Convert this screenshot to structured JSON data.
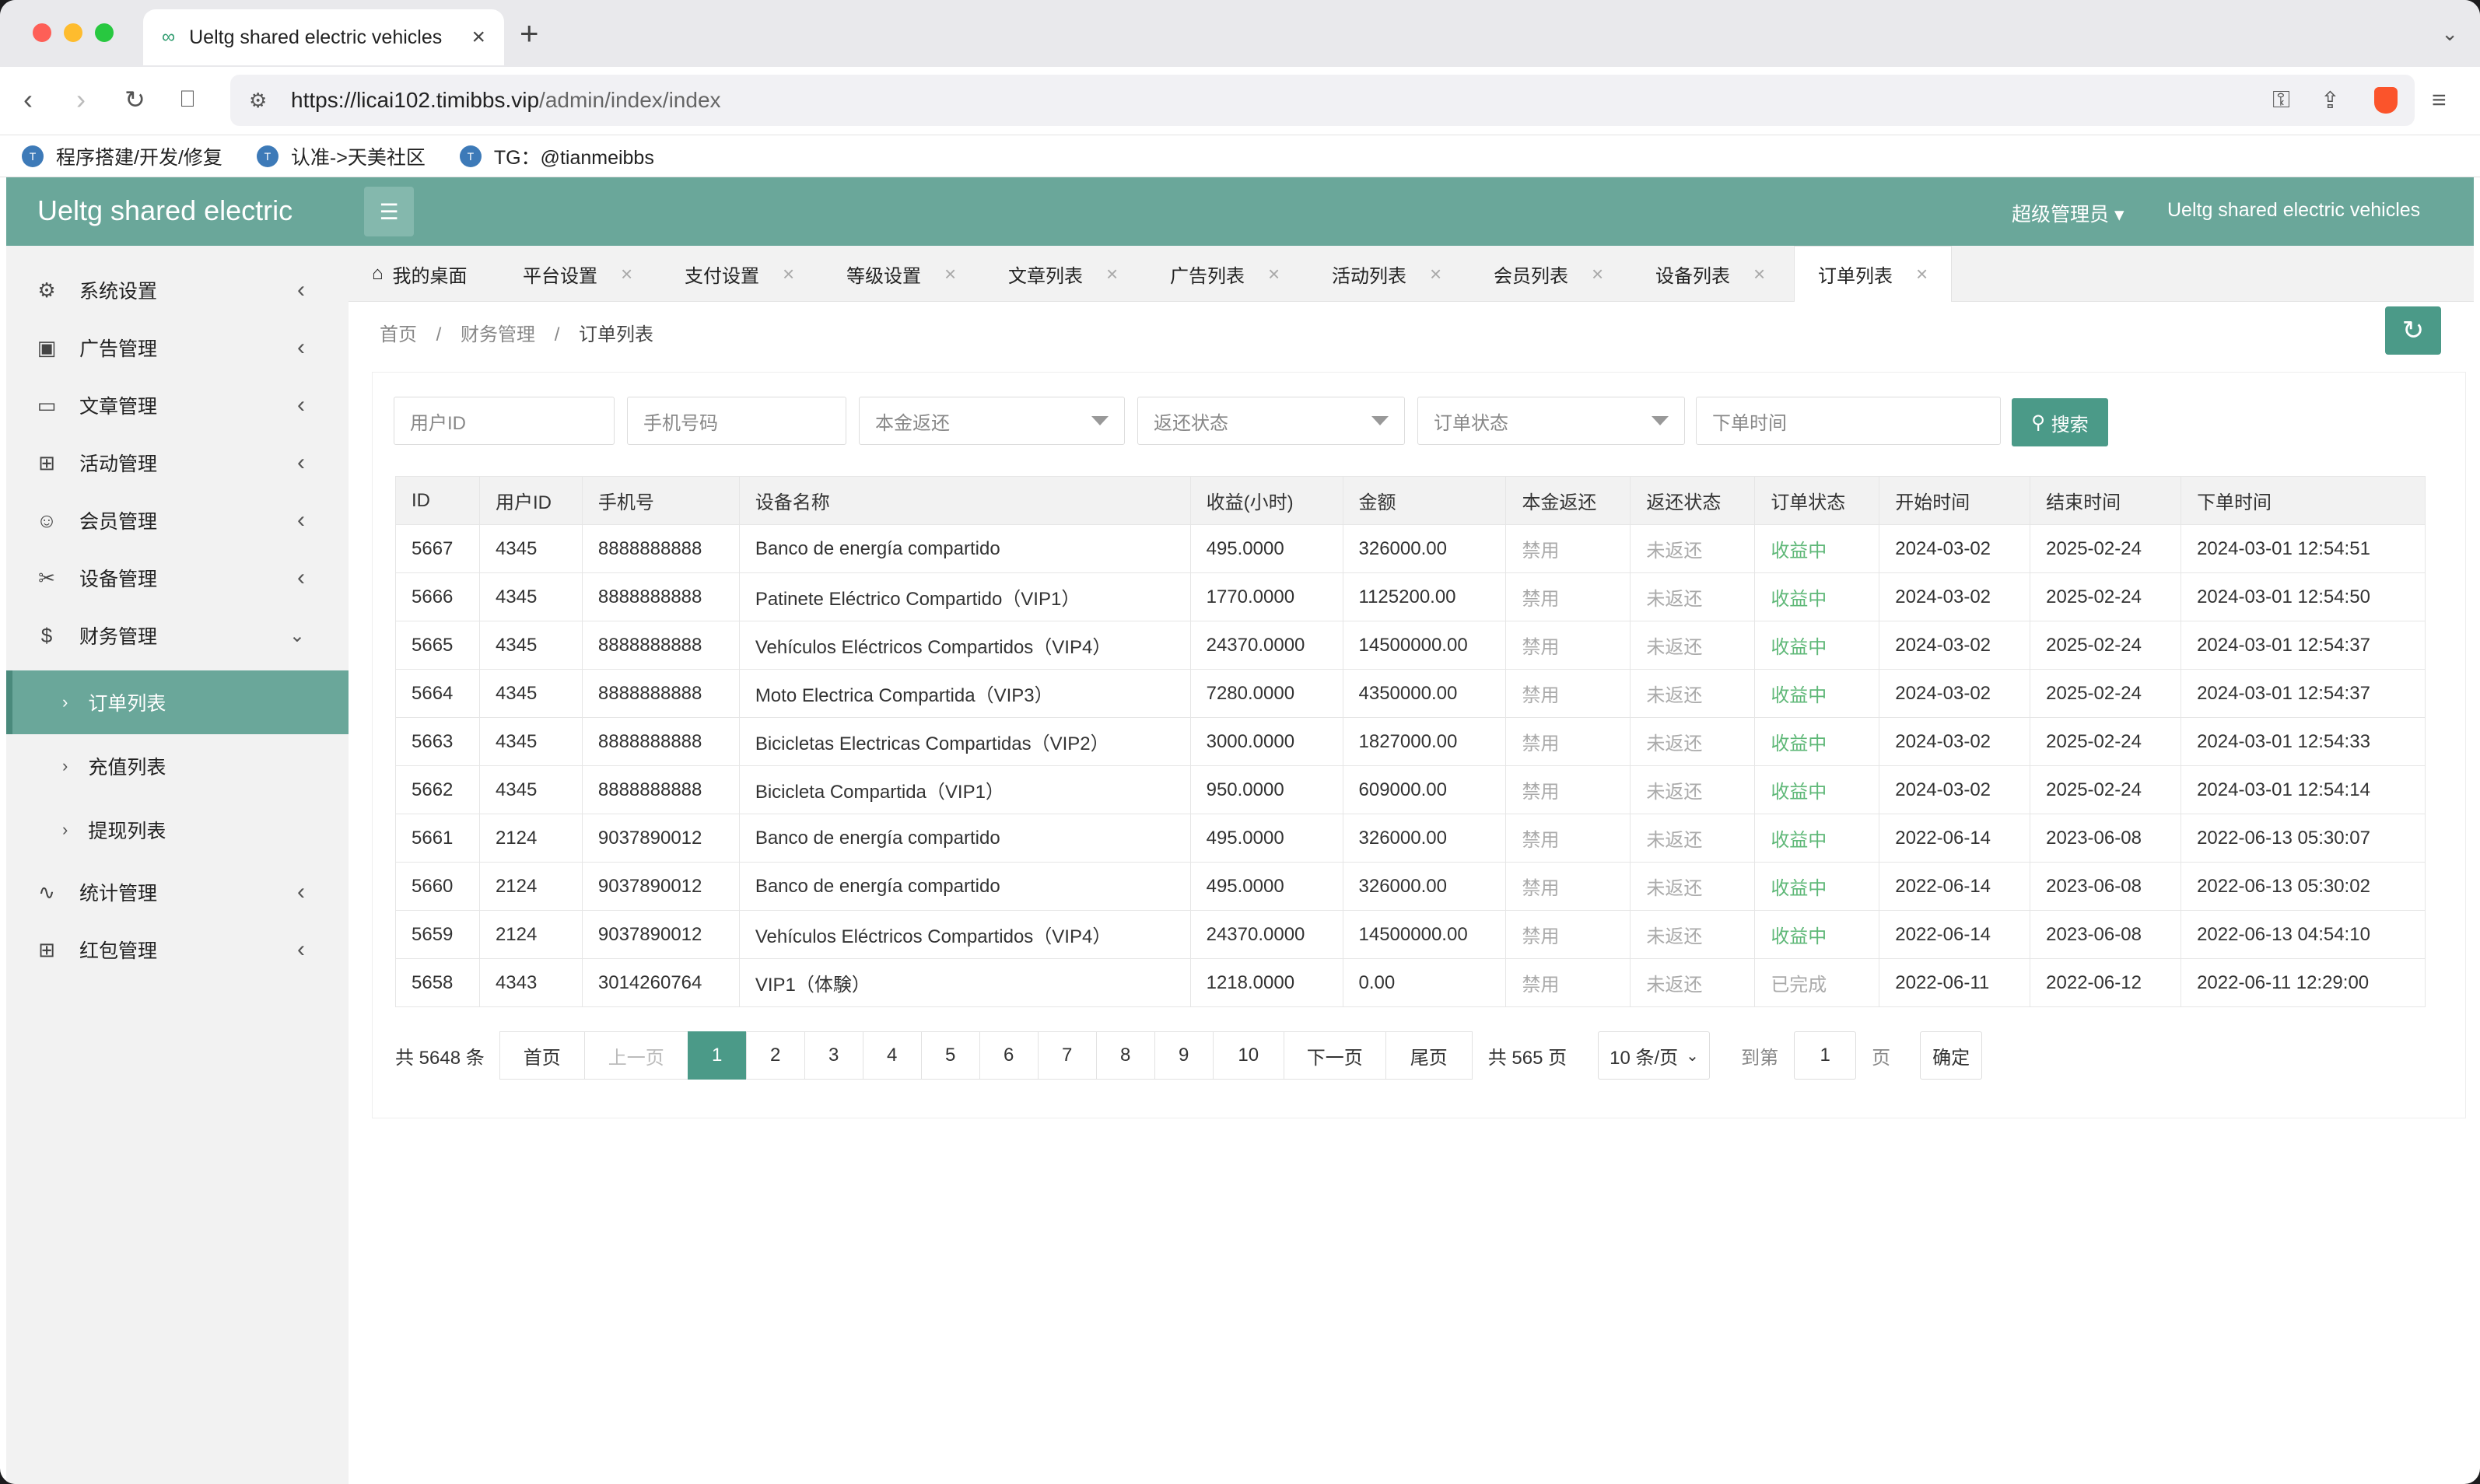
{
  "browser": {
    "tab_title": "Ueltg shared electric vehicles",
    "url_host": "https://licai102.timibbs.vip",
    "url_path": "/admin/index/index",
    "bookmarks": [
      "程序搭建/开发/修复",
      "认准->天美社区",
      "TG：@tianmeibbs"
    ]
  },
  "header": {
    "logo": "Ueltg shared electric",
    "user": "超级管理员",
    "site_name": "Ueltg shared electric vehicles"
  },
  "sidebar": {
    "items": [
      {
        "label": "系统设置",
        "icon": "gear-icon"
      },
      {
        "label": "广告管理",
        "icon": "image-icon"
      },
      {
        "label": "文章管理",
        "icon": "book-icon"
      },
      {
        "label": "活动管理",
        "icon": "gift-icon"
      },
      {
        "label": "会员管理",
        "icon": "user-icon"
      },
      {
        "label": "设备管理",
        "icon": "tools-icon"
      },
      {
        "label": "财务管理",
        "icon": "dollar-icon"
      },
      {
        "label": "统计管理",
        "icon": "pulse-icon"
      },
      {
        "label": "红包管理",
        "icon": "gift-icon"
      }
    ],
    "finance_sub": [
      "订单列表",
      "充值列表",
      "提现列表"
    ]
  },
  "tabs": [
    "我的桌面",
    "平台设置",
    "支付设置",
    "等级设置",
    "文章列表",
    "广告列表",
    "活动列表",
    "会员列表",
    "设备列表",
    "订单列表"
  ],
  "breadcrumb": [
    "首页",
    "财务管理",
    "订单列表"
  ],
  "filters": {
    "user_id": "用户ID",
    "phone": "手机号码",
    "principal_return": "本金返还",
    "return_status": "返还状态",
    "order_status": "订单状态",
    "order_time": "下单时间",
    "search": "搜索"
  },
  "table": {
    "headers": [
      "ID",
      "用户ID",
      "手机号",
      "设备名称",
      "收益(小时)",
      "金额",
      "本金返还",
      "返还状态",
      "订单状态",
      "开始时间",
      "结束时间",
      "下单时间"
    ],
    "rows": [
      [
        "5667",
        "4345",
        "8888888888",
        "Banco de energía compartido",
        "495.0000",
        "326000.00",
        "禁用",
        "未返还",
        "收益中",
        "2024-03-02",
        "2025-02-24",
        "2024-03-01 12:54:51"
      ],
      [
        "5666",
        "4345",
        "8888888888",
        "Patinete Eléctrico Compartido（VIP1）",
        "1770.0000",
        "1125200.00",
        "禁用",
        "未返还",
        "收益中",
        "2024-03-02",
        "2025-02-24",
        "2024-03-01 12:54:50"
      ],
      [
        "5665",
        "4345",
        "8888888888",
        "Vehículos Eléctricos Compartidos（VIP4）",
        "24370.0000",
        "14500000.00",
        "禁用",
        "未返还",
        "收益中",
        "2024-03-02",
        "2025-02-24",
        "2024-03-01 12:54:37"
      ],
      [
        "5664",
        "4345",
        "8888888888",
        "Moto Electrica Compartida（VIP3）",
        "7280.0000",
        "4350000.00",
        "禁用",
        "未返还",
        "收益中",
        "2024-03-02",
        "2025-02-24",
        "2024-03-01 12:54:37"
      ],
      [
        "5663",
        "4345",
        "8888888888",
        "Bicicletas Electricas Compartidas（VIP2）",
        "3000.0000",
        "1827000.00",
        "禁用",
        "未返还",
        "收益中",
        "2024-03-02",
        "2025-02-24",
        "2024-03-01 12:54:33"
      ],
      [
        "5662",
        "4345",
        "8888888888",
        "Bicicleta Compartida（VIP1）",
        "950.0000",
        "609000.00",
        "禁用",
        "未返还",
        "收益中",
        "2024-03-02",
        "2025-02-24",
        "2024-03-01 12:54:14"
      ],
      [
        "5661",
        "2124",
        "9037890012",
        "Banco de energía compartido",
        "495.0000",
        "326000.00",
        "禁用",
        "未返还",
        "收益中",
        "2022-06-14",
        "2023-06-08",
        "2022-06-13 05:30:07"
      ],
      [
        "5660",
        "2124",
        "9037890012",
        "Banco de energía compartido",
        "495.0000",
        "326000.00",
        "禁用",
        "未返还",
        "收益中",
        "2022-06-14",
        "2023-06-08",
        "2022-06-13 05:30:02"
      ],
      [
        "5659",
        "2124",
        "9037890012",
        "Vehículos Eléctricos Compartidos（VIP4）",
        "24370.0000",
        "14500000.00",
        "禁用",
        "未返还",
        "收益中",
        "2022-06-14",
        "2023-06-08",
        "2022-06-13 04:54:10"
      ],
      [
        "5658",
        "4343",
        "3014260764",
        "VIP1（体験）",
        "1218.0000",
        "0.00",
        "禁用",
        "未返还",
        "已完成",
        "2022-06-11",
        "2022-06-12",
        "2022-06-11 12:29:00"
      ]
    ]
  },
  "pagination": {
    "total": "共 5648 条",
    "first": "首页",
    "prev": "上一页",
    "pages": [
      "1",
      "2",
      "3",
      "4",
      "5",
      "6",
      "7",
      "8",
      "9",
      "10"
    ],
    "next": "下一页",
    "last": "尾页",
    "page_count": "共 565 页",
    "page_size": "10 条/页",
    "goto": "到第",
    "goto_value": "1",
    "page_unit": "页",
    "confirm": "确定"
  },
  "colors": {
    "accent": "#6aa79a",
    "button": "#4b9a88",
    "active_status": "#5fb878"
  }
}
